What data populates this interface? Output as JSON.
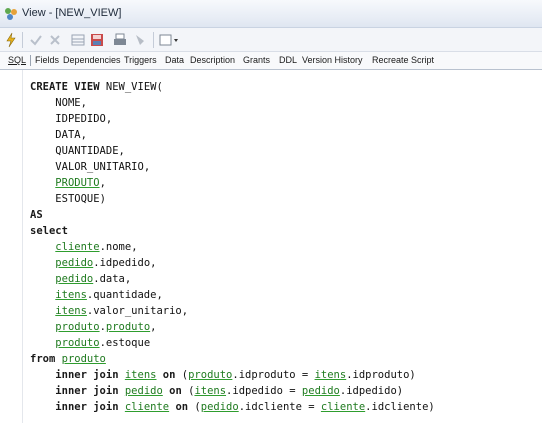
{
  "window": {
    "title": "View - [NEW_VIEW]"
  },
  "tabs": [
    "SQL",
    "Fields",
    "Dependencies",
    "Triggers",
    "Data",
    "Description",
    "Grants",
    "DDL",
    "Version History",
    "Recreate Script"
  ],
  "sql": [
    "CREATE VIEW NEW_VIEW(",
    "    NOME,",
    "    IDPEDIDO,",
    "    DATA,",
    "    QUANTIDADE,",
    "    VALOR_UNITARIO,",
    "    PRODUTO,",
    "    ESTOQUE)",
    "AS",
    "select",
    "    cliente.nome,",
    "    pedido.idpedido,",
    "    pedido.data,",
    "    itens.quantidade,",
    "    itens.valor_unitario,",
    "    produto.produto,",
    "    produto.estoque",
    "from produto",
    "    inner join itens on (produto.idproduto = itens.idproduto)",
    "    inner join pedido on (itens.idpedido = pedido.idpedido)",
    "    inner join cliente on (pedido.idcliente = cliente.idcliente)"
  ],
  "colors": {
    "link": "#1f7a1f",
    "underline": "#2e9d2e",
    "titlebar": "#e9eef6"
  },
  "icons": [
    "view-icon",
    "compile-icon",
    "commit-icon",
    "rollback-icon",
    "grid-icon",
    "save-icon",
    "print-icon",
    "search-icon",
    "dropdown-icon"
  ]
}
